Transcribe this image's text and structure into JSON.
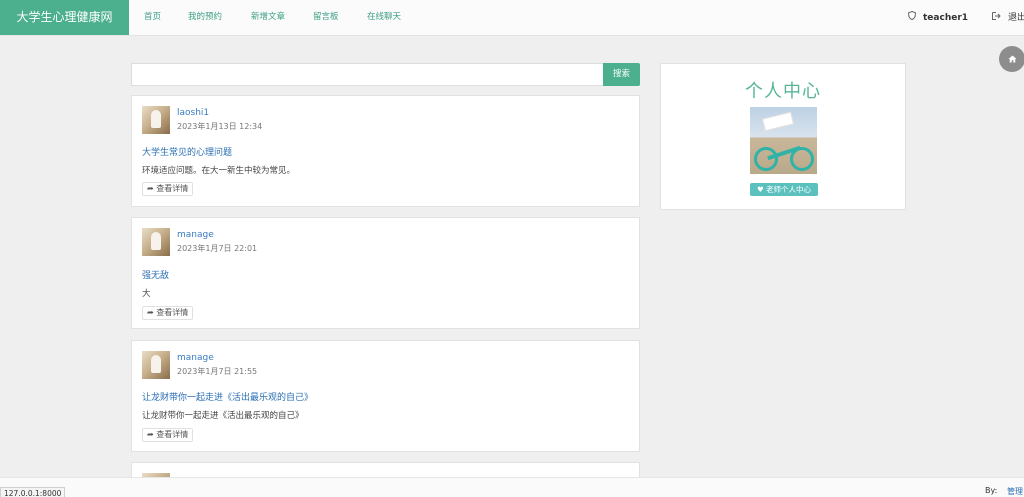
{
  "navbar": {
    "brand": "大学生心理健康网",
    "links": [
      "首页",
      "我的预约",
      "新增文章",
      "留言板",
      "在线聊天"
    ],
    "user": "teacher1",
    "logout": "退出",
    "user_icon": "user-shield-icon",
    "logout_icon": "sign-out-icon"
  },
  "search": {
    "placeholder": "",
    "button": "搜索"
  },
  "posts": [
    {
      "author": "laoshi1",
      "date": "2023年1月13日 12:34",
      "title": "大学生常见的心理问题",
      "excerpt": "环境适应问题。在大一新生中较为常见。",
      "more": "查看详情"
    },
    {
      "author": "manage",
      "date": "2023年1月7日 22:01",
      "title": "强无敌",
      "excerpt": "大",
      "more": "查看详情"
    },
    {
      "author": "manage",
      "date": "2023年1月7日 21:55",
      "title": "让龙财带你一起走进《活出最乐观的自己》",
      "excerpt": "让龙财带你一起走进《活出最乐观的自己》",
      "more": "查看详情"
    }
  ],
  "profile": {
    "title": "个人中心",
    "button": "老师个人中心",
    "button_icon": "heart-icon"
  },
  "home_icon": "home-icon",
  "footer": {
    "by_label": "By:",
    "admin": "管理"
  },
  "status_url": "127.0.0.1:8000",
  "colors": {
    "brand": "#4caf8e",
    "link": "#2a6fb3",
    "accent": "#5bc0be"
  }
}
